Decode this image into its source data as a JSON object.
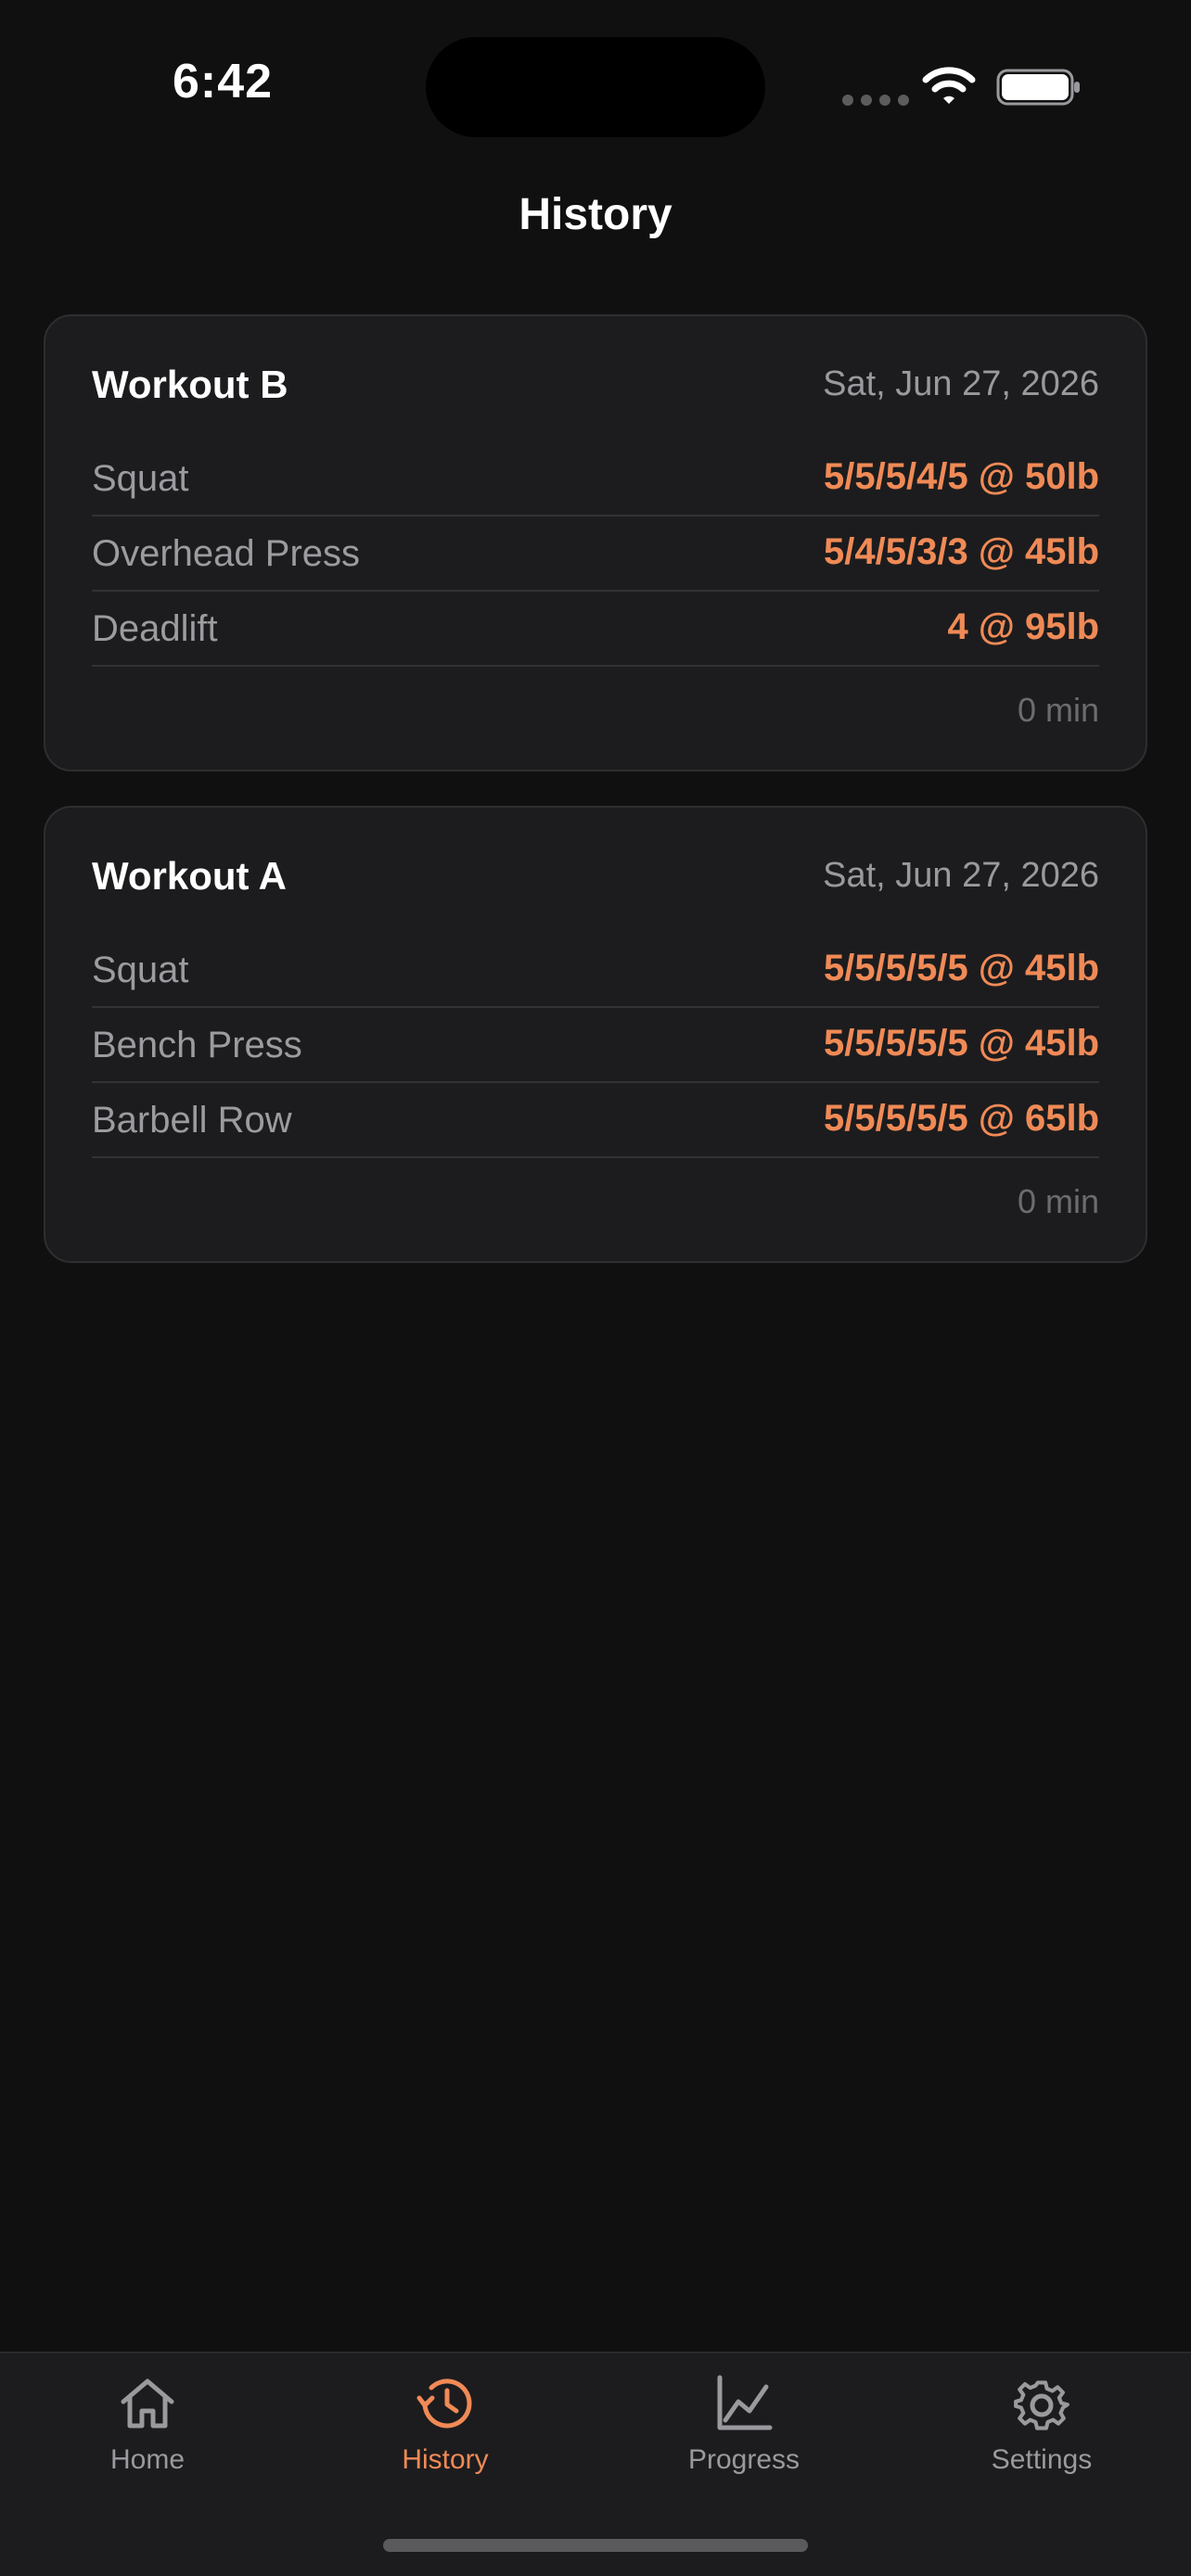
{
  "status_bar": {
    "time": "6:42"
  },
  "header": {
    "title": "History"
  },
  "workouts": [
    {
      "name": "Workout B",
      "date": "Sat, Jun 27, 2026",
      "exercises": [
        {
          "name": "Squat",
          "sets": "5/5/5/4/5 @ 50lb"
        },
        {
          "name": "Overhead Press",
          "sets": "5/4/5/3/3 @ 45lb"
        },
        {
          "name": "Deadlift",
          "sets": "4 @ 95lb"
        }
      ],
      "duration": "0 min"
    },
    {
      "name": "Workout A",
      "date": "Sat, Jun 27, 2026",
      "exercises": [
        {
          "name": "Squat",
          "sets": "5/5/5/5/5 @ 45lb"
        },
        {
          "name": "Bench Press",
          "sets": "5/5/5/5/5 @ 45lb"
        },
        {
          "name": "Barbell Row",
          "sets": "5/5/5/5/5 @ 65lb"
        }
      ],
      "duration": "0 min"
    }
  ],
  "tab_bar": {
    "active": "History",
    "tabs": [
      {
        "label": "Home",
        "icon": "home-icon"
      },
      {
        "label": "History",
        "icon": "history-icon"
      },
      {
        "label": "Progress",
        "icon": "chart-icon"
      },
      {
        "label": "Settings",
        "icon": "gear-icon"
      }
    ]
  },
  "colors": {
    "background": "#101010",
    "card": "#1c1c1e",
    "accent": "#f08a56",
    "muted_text": "#9b9ba0"
  }
}
